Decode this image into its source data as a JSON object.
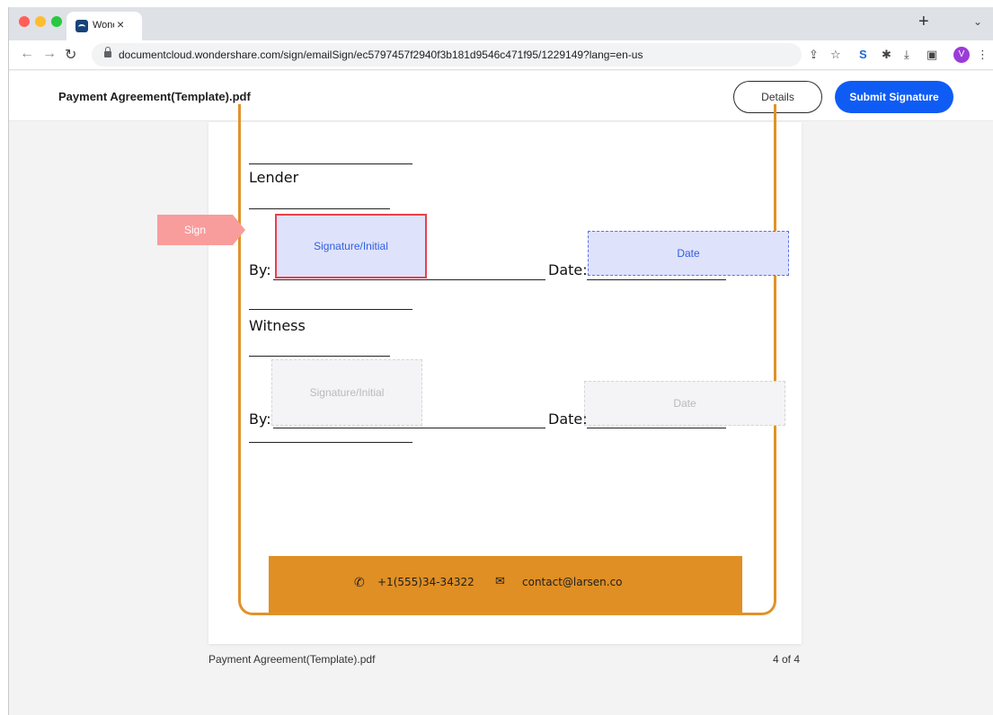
{
  "browser": {
    "tab_title": "Wondershare",
    "tab_close": "×",
    "new_tab": "+",
    "tab_menu": "⌄",
    "url": "documentcloud.wondershare.com/sign/emailSign/ec5797457f2940f3b181d9546c471f95/1229149?lang=en-us",
    "profile_initial": "V",
    "traffic_light_colors": [
      "#ff5f57",
      "#febc2e",
      "#28c840"
    ]
  },
  "header": {
    "document_title": "Payment Agreement(Template).pdf",
    "details_label": "Details",
    "submit_label": "Submit Signature",
    "submit_color": "#0f5cf5"
  },
  "document": {
    "lender_label": "Lender",
    "witness_label": "Witness",
    "by_label": "By:",
    "date_label": "Date:",
    "sign_tag": "Sign",
    "lender_signature_field": "Signature/Initial",
    "lender_date_field": "Date",
    "witness_signature_field": "Signature/Initial",
    "witness_date_field": "Date",
    "phone": "+1(555)34-34322",
    "email": "contact@larsen.co",
    "accent_color": "#df9329"
  },
  "footer": {
    "file_name": "Payment Agreement(Template).pdf",
    "page_indicator": "4 of 4"
  }
}
